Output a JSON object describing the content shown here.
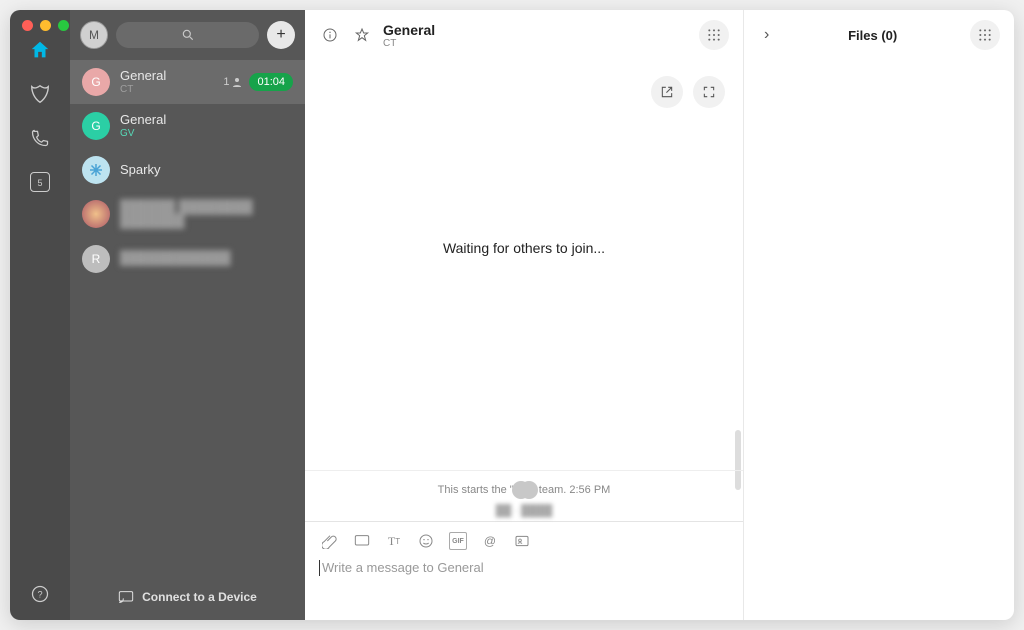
{
  "nav": {
    "calendar_day": "5"
  },
  "user": {
    "avatar_initial": "M"
  },
  "sidebar": {
    "add_label": "+",
    "connect_label": "Connect to a Device",
    "items": [
      {
        "title": "General",
        "subtitle": "CT",
        "people": "1",
        "timer": "01:04"
      },
      {
        "title": "General",
        "subtitle": "GV"
      },
      {
        "title": "Sparky"
      },
      {
        "title": ""
      },
      {
        "initial": "R",
        "title": ""
      }
    ]
  },
  "chat": {
    "title": "General",
    "subtitle": "CT",
    "waiting_text": "Waiting for others to join...",
    "history_prefix": "This starts the \"",
    "history_suffix": "team. 2:56 PM",
    "compose_placeholder": "Write a message to General",
    "gif_label": "GIF"
  },
  "files": {
    "title": "Files (0)"
  }
}
